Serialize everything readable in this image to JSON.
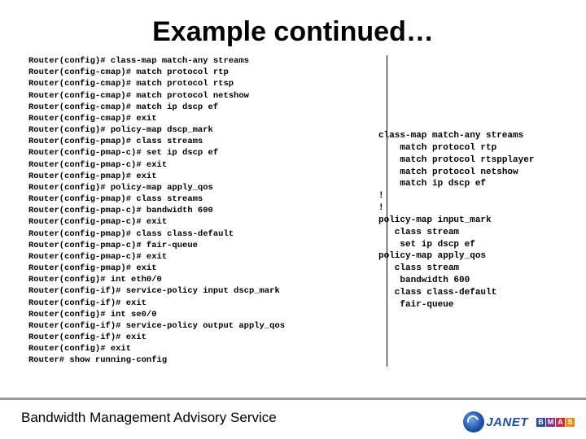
{
  "title": "Example continued…",
  "console_block": "Router(config)# class-map match-any streams\nRouter(config-cmap)# match protocol rtp\nRouter(config-cmap)# match protocol rtsp\nRouter(config-cmap)# match protocol netshow\nRouter(config-cmap)# match ip dscp ef\nRouter(config-cmap)# exit\nRouter(config)# policy-map dscp_mark\nRouter(config-pmap)# class streams\nRouter(config-pmap-c)# set ip dscp ef\nRouter(config-pmap-c)# exit\nRouter(config-pmap)# exit\nRouter(config)# policy-map apply_qos\nRouter(config-pmap)# class streams\nRouter(config-pmap-c)# bandwidth 600\nRouter(config-pmap-c)# exit\nRouter(config-pmap)# class class-default\nRouter(config-pmap-c)# fair-queue\nRouter(config-pmap-c)# exit\nRouter(config-pmap)# exit\nRouter(config)# int eth0/0\nRouter(config-if)# service-policy input dscp_mark\nRouter(config-if)# exit\nRouter(config)# int se0/0\nRouter(config-if)# service-policy output apply_qos\nRouter(config-if)# exit\nRouter(config)# exit\nRouter# show running-config",
  "summary_block": "class-map match-any streams\n    match protocol rtp\n    match protocol rtspplayer\n    match protocol netshow\n    match ip dscp ef\n!\n!\npolicy-map input_mark\n   class stream\n    set ip dscp ef\npolicy-map apply_qos\n   class stream\n    bandwidth 600\n   class class-default\n    fair-queue",
  "footer": {
    "service_name": "Bandwidth Management Advisory Service",
    "janet_label": "JANET"
  },
  "bmas_letters": [
    "B",
    "M",
    "A",
    "S"
  ]
}
